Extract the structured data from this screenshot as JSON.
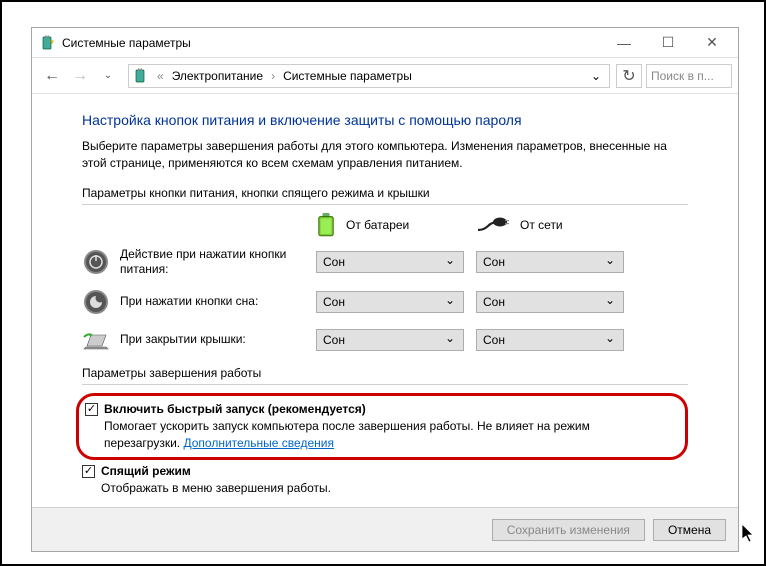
{
  "window": {
    "title": "Системные параметры"
  },
  "breadcrumb": {
    "lvl1": "Электропитание",
    "lvl2": "Системные параметры"
  },
  "search": {
    "placeholder": "Поиск в п..."
  },
  "main": {
    "heading": "Настройка кнопок питания и включение защиты с помощью пароля",
    "intro": "Выберите параметры завершения работы для этого компьютера. Изменения параметров, внесенные на этой странице, применяются ко всем схемам управления питанием.",
    "section1_title": "Параметры кнопки питания, кнопки спящего режима и крышки",
    "col_battery": "От батареи",
    "col_ac": "От сети",
    "row1_label": "Действие при нажатии кнопки питания:",
    "row2_label": "При нажатии кнопки сна:",
    "row3_label": "При закрытии крышки:",
    "option_sleep": "Сон",
    "section2_title": "Параметры завершения работы",
    "fast_start_title": "Включить быстрый запуск (рекомендуется)",
    "fast_start_desc1": "Помогает ускорить запуск компьютера после завершения работы. Не влияет на режим перезагрузки. ",
    "fast_start_link": "Дополнительные сведения",
    "sleep_mode_title": "Спящий режим",
    "sleep_mode_desc": "Отображать в меню завершения работы."
  },
  "footer": {
    "save": "Сохранить изменения",
    "cancel": "Отмена"
  }
}
